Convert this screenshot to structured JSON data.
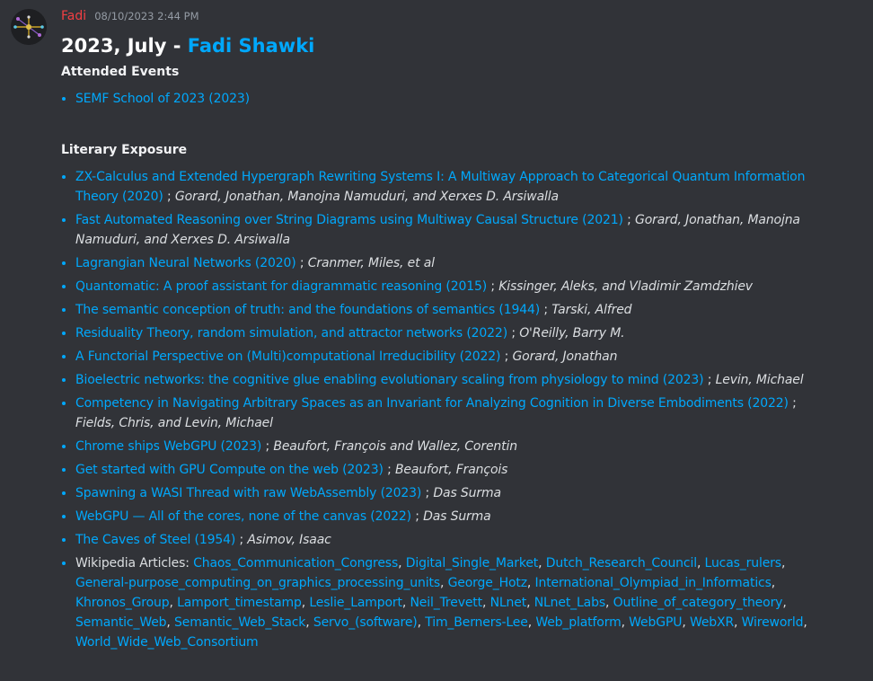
{
  "message": {
    "author": "Fadi",
    "timestamp": "08/10/2023 2:44 PM",
    "title_prefix": "2023, July - ",
    "title_link": "Fadi Shawki",
    "attended_heading": "Attended Events",
    "events": [
      "SEMF School of 2023 (2023)"
    ],
    "literary_heading": "Literary Exposure",
    "literature": [
      {
        "title": "ZX-Calculus and Extended Hypergraph Rewriting Systems I: A Multiway Approach to Categorical Quantum Information Theory (2020)",
        "authors": "Gorard, Jonathan, Manojna Namuduri, and Xerxes D. Arsiwalla"
      },
      {
        "title": "Fast Automated Reasoning over String Diagrams using Multiway Causal Structure (2021)",
        "authors": "Gorard, Jonathan, Manojna Namuduri, and Xerxes D. Arsiwalla"
      },
      {
        "title": "Lagrangian Neural Networks (2020)",
        "authors": "Cranmer, Miles, et al"
      },
      {
        "title": "Quantomatic: A proof assistant for diagrammatic reasoning (2015)",
        "authors": "Kissinger, Aleks, and Vladimir Zamdzhiev"
      },
      {
        "title": "The semantic conception of truth: and the foundations of semantics (1944)",
        "authors": "Tarski, Alfred"
      },
      {
        "title": "Residuality Theory, random simulation, and attractor networks (2022)",
        "authors": "O'Reilly, Barry M."
      },
      {
        "title": "A Functorial Perspective on (Multi)computational Irreducibility (2022)",
        "authors": "Gorard, Jonathan"
      },
      {
        "title": "Bioelectric networks: the cognitive glue enabling evolutionary scaling from physiology to mind (2023)",
        "authors": "Levin, Michael"
      },
      {
        "title": "Competency in Navigating Arbitrary Spaces as an Invariant for Analyzing Cognition in Diverse Embodiments (2022)",
        "authors": "Fields, Chris, and Levin, Michael"
      },
      {
        "title": "Chrome ships WebGPU (2023)",
        "authors": "Beaufort, François and Wallez, Corentin"
      },
      {
        "title": "Get started with GPU Compute on the web (2023)",
        "authors": "Beaufort, François"
      },
      {
        "title": "Spawning a WASI Thread with raw WebAssembly (2023)",
        "authors": "Das Surma"
      },
      {
        "title": "WebGPU — All of the cores, none of the canvas (2022)",
        "authors": "Das Surma"
      },
      {
        "title": "The Caves of Steel (1954)",
        "authors": "Asimov, Isaac"
      }
    ],
    "separator": " ; ",
    "wiki_label": "Wikipedia Articles: ",
    "wiki_articles": [
      "Chaos_Communication_Congress",
      "Digital_Single_Market",
      "Dutch_Research_Council",
      "Lucas_rulers",
      "General-purpose_computing_on_graphics_processing_units",
      "George_Hotz",
      "International_Olympiad_in_Informatics",
      "Khronos_Group",
      "Lamport_timestamp",
      "Leslie_Lamport",
      "Neil_Trevett",
      "NLnet",
      "NLnet_Labs",
      "Outline_of_category_theory",
      "Semantic_Web",
      "Semantic_Web_Stack",
      "Servo_(software)",
      "Tim_Berners-Lee",
      "Web_platform",
      "WebGPU",
      "WebXR",
      "Wireworld",
      "World_Wide_Web_Consortium"
    ],
    "wiki_separator": ", "
  },
  "colors": {
    "background": "#313338",
    "link": "#00a8fc",
    "author": "#f23f43",
    "text": "#dbdee1",
    "muted": "#949ba4"
  },
  "icons": {
    "avatar": "avatar-graph-icon"
  }
}
